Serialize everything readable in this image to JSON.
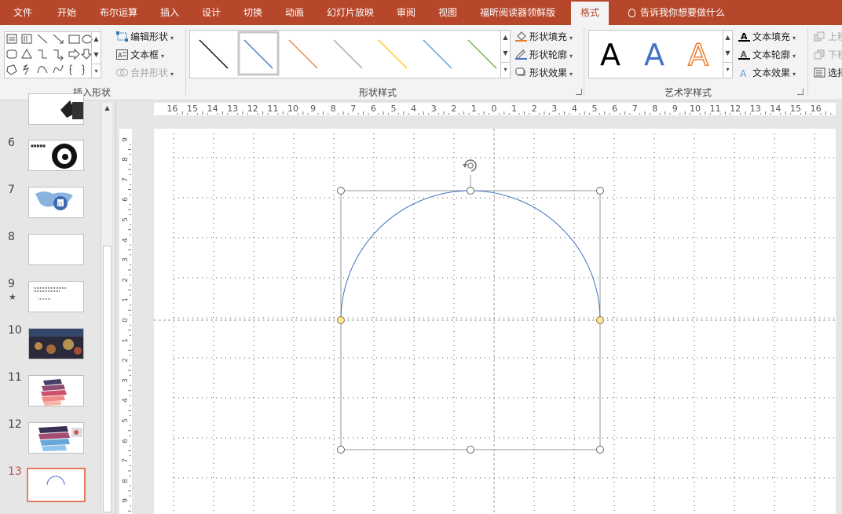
{
  "tabs": [
    {
      "label": "文件",
      "active": false
    },
    {
      "label": "开始",
      "active": false
    },
    {
      "label": "布尔运算",
      "active": false
    },
    {
      "label": "插入",
      "active": false
    },
    {
      "label": "设计",
      "active": false
    },
    {
      "label": "切换",
      "active": false
    },
    {
      "label": "动画",
      "active": false
    },
    {
      "label": "幻灯片放映",
      "active": false
    },
    {
      "label": "审阅",
      "active": false
    },
    {
      "label": "视图",
      "active": false
    },
    {
      "label": "福昕阅读器领鲜版",
      "active": false
    },
    {
      "label": "格式",
      "active": true
    }
  ],
  "tell_me": "告诉我你想要做什么",
  "ribbon": {
    "insert_shapes": {
      "label": "插入形状",
      "edit_shape": "编辑形状",
      "text_box": "文本框",
      "merge_shapes": "合并形状"
    },
    "shape_styles": {
      "label": "形状样式",
      "line_colors": [
        "#000000",
        "#4472c4",
        "#ed7d31",
        "#a5a5a5",
        "#ffc000",
        "#5b9bd5",
        "#70ad47"
      ],
      "fill": "形状填充",
      "outline": "形状轮廓",
      "effects": "形状效果"
    },
    "wordart_styles": {
      "label": "艺术字样式",
      "glyph": "A",
      "text_fill": "文本填充",
      "text_outline": "文本轮廓",
      "text_effects": "文本效果"
    },
    "arrange": {
      "bring_forward": "上移",
      "send_backward": "下移",
      "selection_pane": "选择"
    }
  },
  "slides": [
    {
      "number": "6",
      "starred": false
    },
    {
      "number": "7",
      "starred": false
    },
    {
      "number": "8",
      "starred": false
    },
    {
      "number": "9",
      "starred": true
    },
    {
      "number": "10",
      "starred": false
    },
    {
      "number": "11",
      "starred": false
    },
    {
      "number": "12",
      "starred": false
    },
    {
      "number": "13",
      "starred": false,
      "active": true
    }
  ],
  "star_glyph": "★",
  "rulers": {
    "horizontal": [
      "16",
      "15",
      "14",
      "13",
      "12",
      "11",
      "10",
      "9",
      "8",
      "7",
      "6",
      "5",
      "4",
      "3",
      "2",
      "1",
      "0",
      "1",
      "2",
      "3",
      "4",
      "5",
      "6",
      "7",
      "8",
      "9",
      "10",
      "11",
      "12",
      "13",
      "14",
      "15",
      "16"
    ],
    "vertical": [
      "9",
      "8",
      "7",
      "6",
      "5",
      "4",
      "3",
      "2",
      "1",
      "0",
      "1",
      "2",
      "3",
      "4",
      "5",
      "6",
      "7",
      "8",
      "9"
    ]
  },
  "canvas": {
    "arc_color": "#4472c4"
  },
  "colors": {
    "accent": "#b7472a",
    "selection_handle": "#ffffff",
    "adjust_handle": "#ffe699"
  }
}
